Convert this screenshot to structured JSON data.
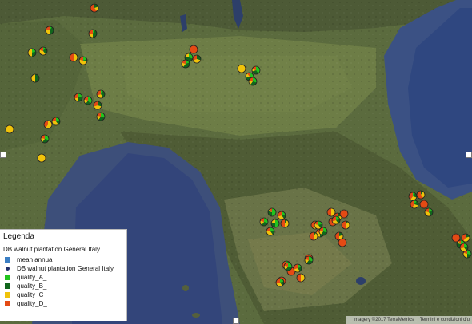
{
  "colors": {
    "mean_annua": "#3b7fc4",
    "quality_A": "#22c41e",
    "quality_B": "#12661c",
    "quality_C": "#f0c30a",
    "quality_D": "#e44a14",
    "plantation_point": "#1f2f6a"
  },
  "legend": {
    "title": "Legenda",
    "layer_name": "DB walnut plantation General Italy",
    "items": [
      {
        "label": "mean annua",
        "symbol": "square",
        "color_key": "mean_annua"
      },
      {
        "label": "DB walnut plantation General Italy",
        "symbol": "dot",
        "color_key": "plantation_point"
      },
      {
        "label": "quality_A_",
        "symbol": "square",
        "color_key": "quality_A"
      },
      {
        "label": "quality_B_",
        "symbol": "square",
        "color_key": "quality_B"
      },
      {
        "label": "quality_C_",
        "symbol": "square",
        "color_key": "quality_C"
      },
      {
        "label": "quality_D_",
        "symbol": "square",
        "color_key": "quality_D"
      }
    ]
  },
  "attribution": {
    "imagery": "Imagery ©2017 TerraMetrics",
    "terms": "Termini e condizioni d'u"
  },
  "pie_markers": [
    {
      "site": "piemonte-north-1",
      "segments": {
        "A": 0.2,
        "B": 0.2,
        "C": 0.3,
        "D": 0.3
      }
    },
    {
      "site": "piemonte-north-2",
      "segments": {
        "A": 0.1,
        "B": 0.4,
        "C": 0.2,
        "D": 0.3
      }
    },
    {
      "site": "piemonte-north-3",
      "segments": {
        "A": 0.0,
        "B": 0.2,
        "C": 0.2,
        "D": 0.6
      }
    },
    {
      "site": "piemonte-north-4",
      "segments": {
        "A": 0.2,
        "B": 0.3,
        "C": 0.5,
        "D": 0.0
      }
    },
    {
      "site": "piemonte-north-5",
      "segments": {
        "A": 0.1,
        "B": 0.3,
        "C": 0.4,
        "D": 0.2
      }
    },
    {
      "site": "piemonte-north-6",
      "segments": {
        "A": 0.0,
        "B": 0.0,
        "C": 0.5,
        "D": 0.5
      }
    },
    {
      "site": "piemonte-north-7",
      "segments": {
        "A": 0.2,
        "B": 0.1,
        "C": 0.5,
        "D": 0.2
      }
    },
    {
      "site": "piemonte-north-8",
      "segments": {
        "A": 0.0,
        "B": 0.5,
        "C": 0.5,
        "D": 0.0
      }
    },
    {
      "site": "piemonte-west-1",
      "segments": {
        "A": 0.0,
        "B": 0.0,
        "C": 1.0,
        "D": 0.0
      }
    },
    {
      "site": "piemonte-center-1",
      "segments": {
        "A": 0.2,
        "B": 0.3,
        "C": 0.2,
        "D": 0.3
      }
    },
    {
      "site": "piemonte-center-2",
      "segments": {
        "A": 0.4,
        "B": 0.2,
        "C": 0.2,
        "D": 0.2
      }
    },
    {
      "site": "piemonte-center-3",
      "segments": {
        "A": 0.1,
        "B": 0.3,
        "C": 0.3,
        "D": 0.3
      }
    },
    {
      "site": "piemonte-center-4",
      "segments": {
        "A": 0.0,
        "B": 0.3,
        "C": 0.4,
        "D": 0.3
      }
    },
    {
      "site": "piemonte-center-5",
      "segments": {
        "A": 0.3,
        "B": 0.3,
        "C": 0.2,
        "D": 0.2
      }
    },
    {
      "site": "piemonte-center-6",
      "segments": {
        "A": 0.0,
        "B": 0.0,
        "C": 0.6,
        "D": 0.4
      }
    },
    {
      "site": "piemonte-center-7",
      "segments": {
        "A": 0.2,
        "B": 0.2,
        "C": 0.4,
        "D": 0.2
      }
    },
    {
      "site": "piemonte-center-8",
      "segments": {
        "A": 0.3,
        "B": 0.3,
        "C": 0.2,
        "D": 0.2
      }
    },
    {
      "site": "piemonte-center-9",
      "segments": {
        "A": 0.0,
        "B": 0.0,
        "C": 1.0,
        "D": 0.0
      }
    },
    {
      "site": "piemonte-south-1",
      "segments": {
        "A": 0.3,
        "B": 0.5,
        "C": 0.2,
        "D": 0.0
      }
    },
    {
      "site": "piemonte-south-2",
      "segments": {
        "A": 0.0,
        "B": 0.3,
        "C": 0.4,
        "D": 0.3
      }
    },
    {
      "site": "piemonte-south-3",
      "segments": {
        "A": 0.0,
        "B": 0.0,
        "C": 0.0,
        "D": 1.0
      }
    },
    {
      "site": "piemonte-south-4",
      "segments": {
        "A": 0.2,
        "B": 0.4,
        "C": 0.2,
        "D": 0.2
      }
    },
    {
      "site": "piemonte-south-5",
      "segments": {
        "A": 0.0,
        "B": 0.0,
        "C": 1.0,
        "D": 0.0
      }
    },
    {
      "site": "lombardia-1",
      "segments": {
        "A": 0.3,
        "B": 0.4,
        "C": 0.2,
        "D": 0.1
      }
    },
    {
      "site": "lombardia-2",
      "segments": {
        "A": 0.3,
        "B": 0.3,
        "C": 0.2,
        "D": 0.2
      }
    },
    {
      "site": "lombardia-3",
      "segments": {
        "A": 0.4,
        "B": 0.3,
        "C": 0.1,
        "D": 0.2
      }
    },
    {
      "site": "lombardia-4",
      "segments": {
        "A": 0.5,
        "B": 0.3,
        "C": 0.1,
        "D": 0.1
      }
    },
    {
      "site": "lombardia-5",
      "segments": {
        "A": 0.2,
        "B": 0.2,
        "C": 0.3,
        "D": 0.3
      }
    },
    {
      "site": "lombardia-6",
      "segments": {
        "A": 0.3,
        "B": 0.3,
        "C": 0.2,
        "D": 0.2
      }
    },
    {
      "site": "lombardia-7",
      "segments": {
        "A": 0.5,
        "B": 0.3,
        "C": 0.2,
        "D": 0.0
      }
    },
    {
      "site": "lombardia-8",
      "segments": {
        "A": 0.2,
        "B": 0.2,
        "C": 0.4,
        "D": 0.2
      }
    },
    {
      "site": "toscana-1",
      "segments": {
        "A": 0.0,
        "B": 0.1,
        "C": 0.4,
        "D": 0.5
      }
    },
    {
      "site": "toscana-2",
      "segments": {
        "A": 0.1,
        "B": 0.2,
        "C": 0.3,
        "D": 0.4
      }
    },
    {
      "site": "toscana-3",
      "segments": {
        "A": 0.2,
        "B": 0.3,
        "C": 0.3,
        "D": 0.2
      }
    },
    {
      "site": "toscana-4",
      "segments": {
        "A": 0.0,
        "B": 0.1,
        "C": 0.4,
        "D": 0.5
      }
    },
    {
      "site": "toscana-5",
      "segments": {
        "A": 0.0,
        "B": 0.0,
        "C": 0.5,
        "D": 0.5
      }
    },
    {
      "site": "toscana-6",
      "segments": {
        "A": 0.0,
        "B": 0.2,
        "C": 0.2,
        "D": 0.6
      }
    },
    {
      "site": "toscana-7",
      "segments": {
        "A": 0.0,
        "B": 0.0,
        "C": 0.0,
        "D": 1.0
      }
    },
    {
      "site": "toscana-8",
      "segments": {
        "A": 0.0,
        "B": 0.1,
        "C": 0.4,
        "D": 0.5
      }
    },
    {
      "site": "toscana-9",
      "segments": {
        "A": 0.0,
        "B": 0.0,
        "C": 0.4,
        "D": 0.6
      }
    },
    {
      "site": "toscana-10",
      "segments": {
        "A": 0.0,
        "B": 0.2,
        "C": 0.3,
        "D": 0.5
      }
    },
    {
      "site": "toscana-11",
      "segments": {
        "A": 0.0,
        "B": 0.0,
        "C": 0.0,
        "D": 1.0
      }
    },
    {
      "site": "toscana-12",
      "segments": {
        "A": 0.1,
        "B": 0.2,
        "C": 0.3,
        "D": 0.4
      }
    },
    {
      "site": "toscana-13",
      "segments": {
        "A": 0.0,
        "B": 0.0,
        "C": 0.0,
        "D": 1.0
      }
    },
    {
      "site": "toscana-14",
      "segments": {
        "A": 0.2,
        "B": 0.2,
        "C": 0.3,
        "D": 0.3
      }
    },
    {
      "site": "toscana-15",
      "segments": {
        "A": 0.0,
        "B": 0.0,
        "C": 0.0,
        "D": 1.0
      }
    },
    {
      "site": "toscana-16",
      "segments": {
        "A": 0.0,
        "B": 0.0,
        "C": 0.5,
        "D": 0.5
      }
    },
    {
      "site": "umbria-1",
      "segments": {
        "A": 0.0,
        "B": 0.0,
        "C": 0.0,
        "D": 1.0
      }
    },
    {
      "site": "umbria-2",
      "segments": {
        "A": 0.1,
        "B": 0.2,
        "C": 0.3,
        "D": 0.4
      }
    },
    {
      "site": "umbria-3",
      "segments": {
        "A": 0.0,
        "B": 0.1,
        "C": 0.3,
        "D": 0.6
      }
    },
    {
      "site": "umbria-4",
      "segments": {
        "A": 0.1,
        "B": 0.2,
        "C": 0.3,
        "D": 0.4
      }
    },
    {
      "site": "umbria-5",
      "segments": {
        "A": 0.0,
        "B": 0.0,
        "C": 0.0,
        "D": 1.0
      }
    },
    {
      "site": "umbria-6",
      "segments": {
        "A": 0.2,
        "B": 0.2,
        "C": 0.4,
        "D": 0.2
      }
    },
    {
      "site": "umbria-7",
      "segments": {
        "A": 0.0,
        "B": 0.0,
        "C": 0.0,
        "D": 1.0
      }
    },
    {
      "site": "umbria-8",
      "segments": {
        "A": 0.0,
        "B": 0.2,
        "C": 0.4,
        "D": 0.4
      }
    },
    {
      "site": "marche-1",
      "segments": {
        "A": 0.4,
        "B": 0.4,
        "C": 0.1,
        "D": 0.1
      }
    },
    {
      "site": "marche-2",
      "segments": {
        "A": 0.3,
        "B": 0.2,
        "C": 0.3,
        "D": 0.2
      }
    },
    {
      "site": "marche-3",
      "segments": {
        "A": 0.2,
        "B": 0.2,
        "C": 0.3,
        "D": 0.3
      }
    },
    {
      "site": "marche-4",
      "segments": {
        "A": 0.3,
        "B": 0.3,
        "C": 0.2,
        "D": 0.2
      }
    },
    {
      "site": "marche-5",
      "segments": {
        "A": 0.2,
        "B": 0.2,
        "C": 0.3,
        "D": 0.3
      }
    },
    {
      "site": "marche-south-1",
      "segments": {
        "A": 0.3,
        "B": 0.3,
        "C": 0.2,
        "D": 0.2
      }
    },
    {
      "site": "marche-south-2",
      "segments": {
        "A": 0.2,
        "B": 0.2,
        "C": 0.4,
        "D": 0.2
      }
    },
    {
      "site": "marche-south-3",
      "segments": {
        "A": 0.3,
        "B": 0.3,
        "C": 0.2,
        "D": 0.2
      }
    },
    {
      "site": "marche-south-4",
      "segments": {
        "A": 0.2,
        "B": 0.2,
        "C": 0.3,
        "D": 0.3
      }
    },
    {
      "site": "marche-south-5",
      "segments": {
        "A": 0.1,
        "B": 0.4,
        "C": 0.3,
        "D": 0.2
      }
    }
  ]
}
